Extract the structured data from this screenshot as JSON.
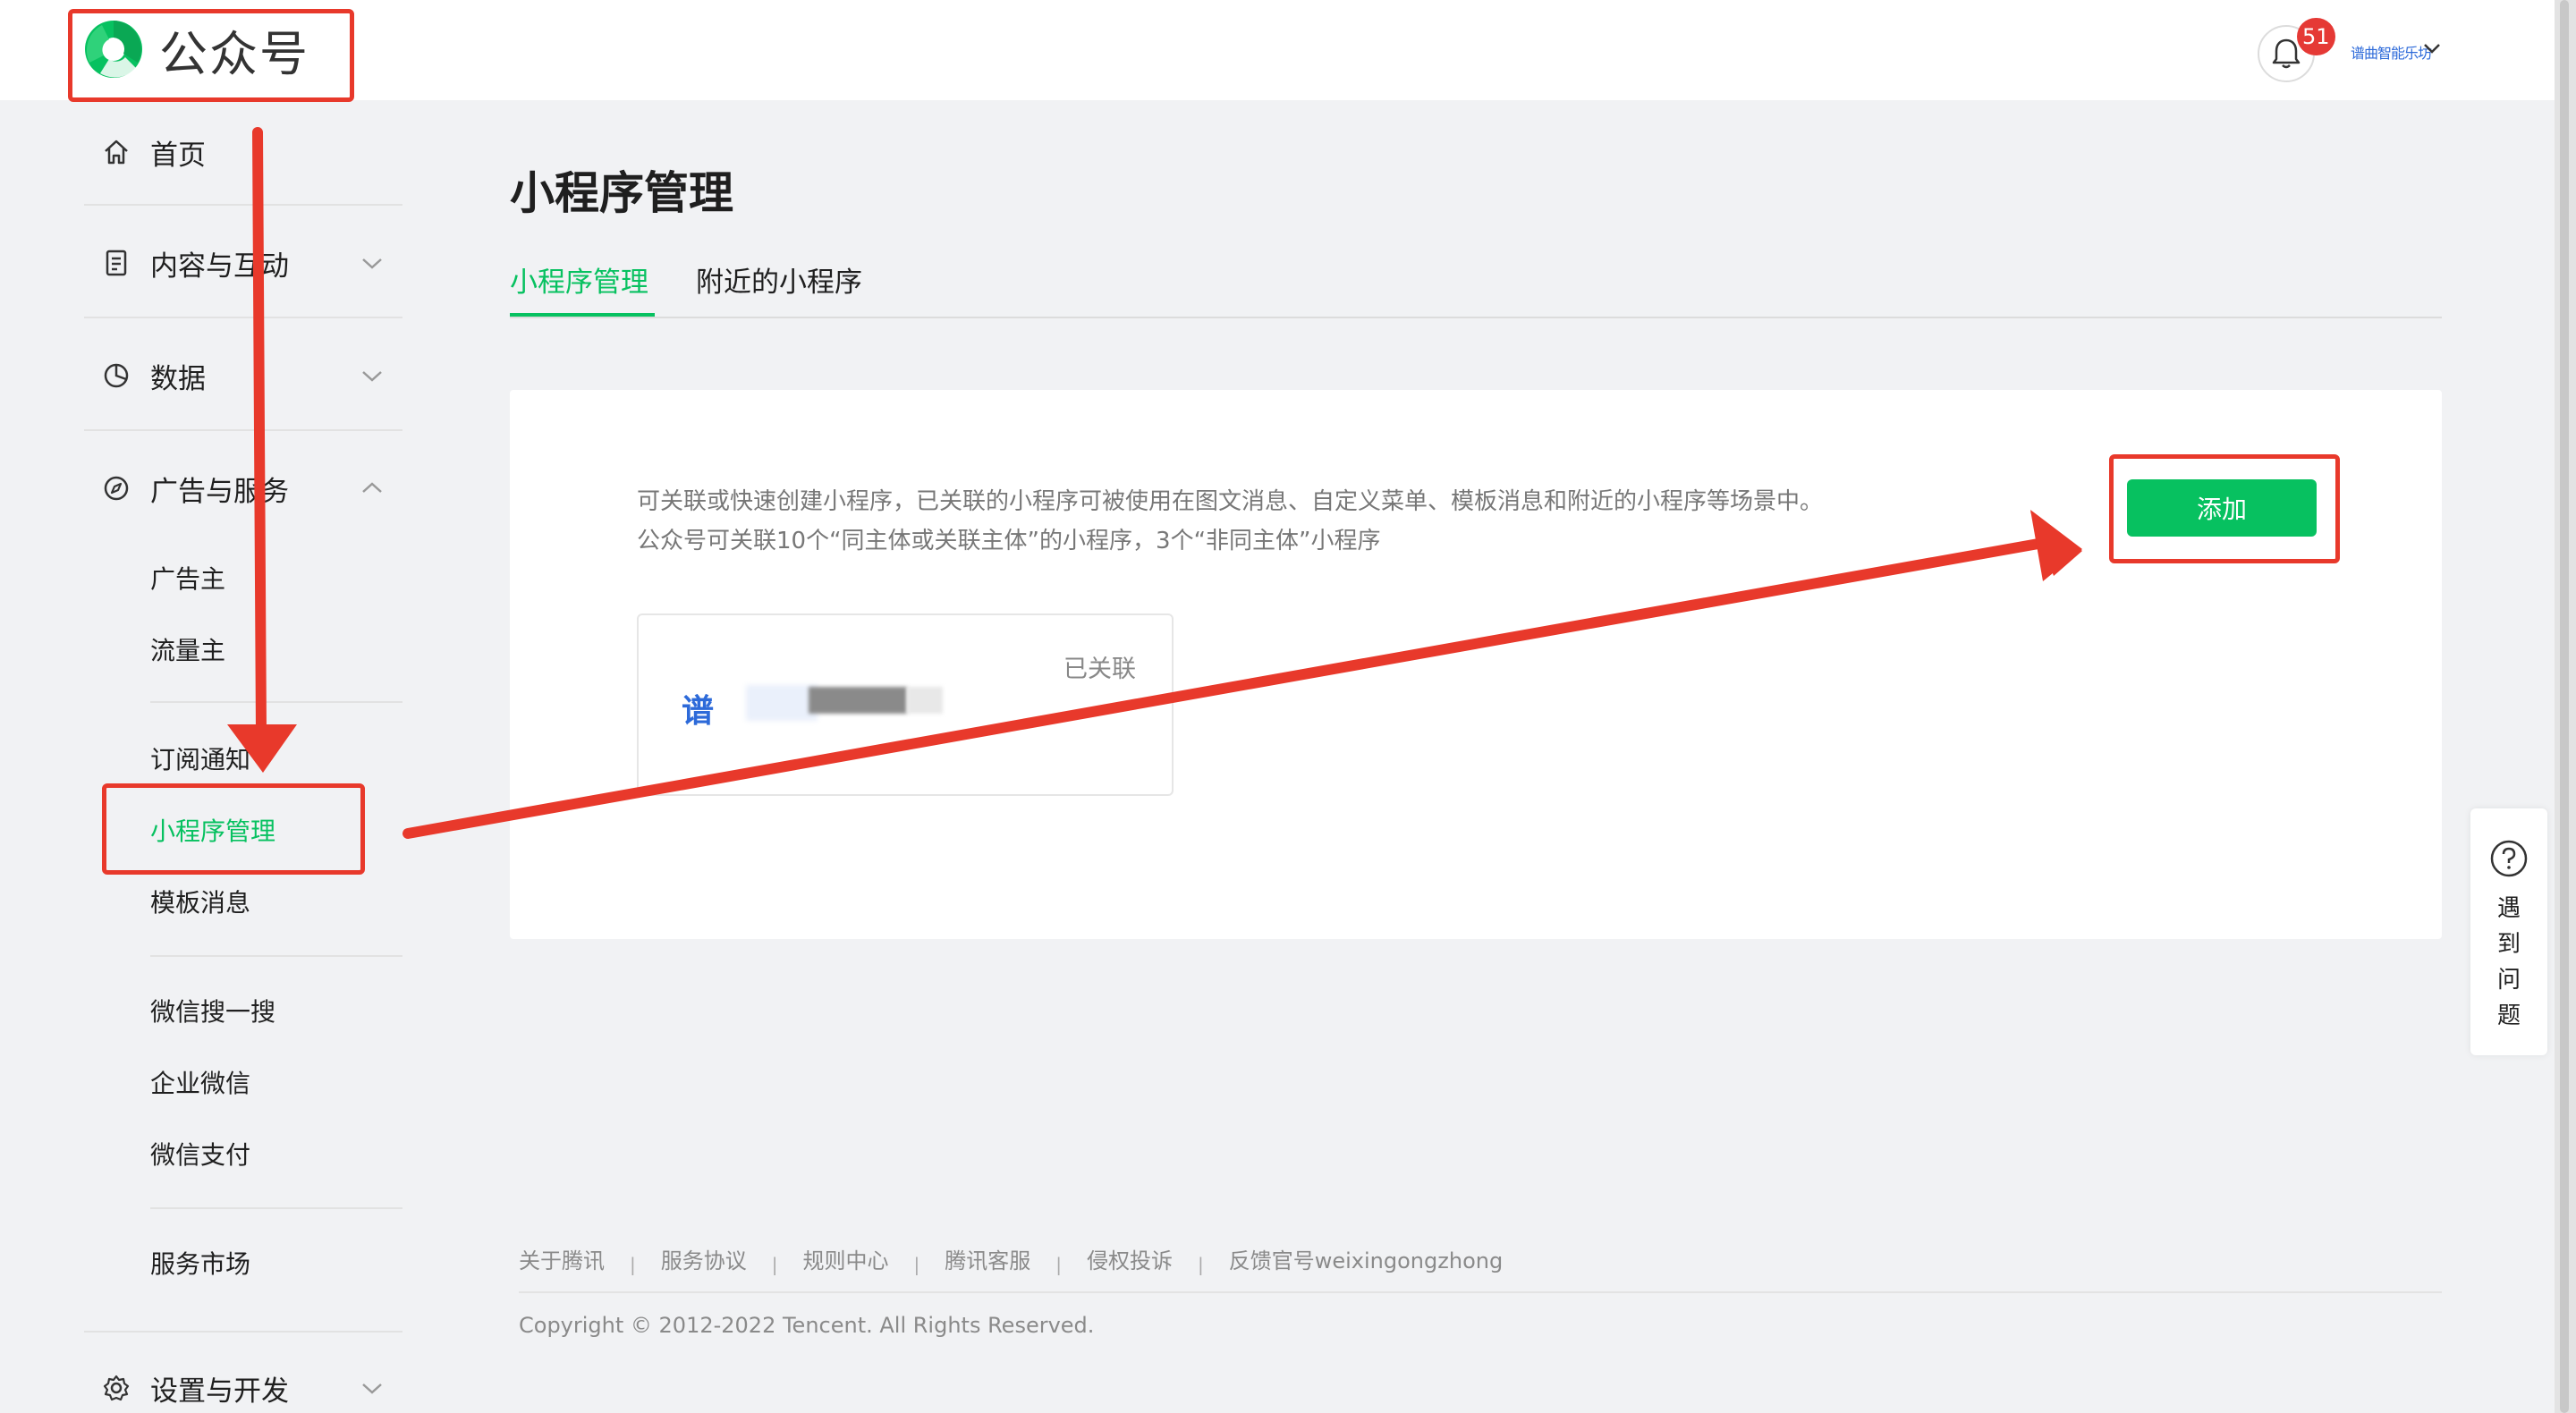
{
  "app": {
    "logo_text": "公众号"
  },
  "header": {
    "notification_count": "51",
    "account_name": "谱曲智能乐坊"
  },
  "sidebar": {
    "home": "首页",
    "content": "内容与互动",
    "data": "数据",
    "ads_services": "广告与服务",
    "sub": {
      "advertiser": "广告主",
      "publisher": "流量主",
      "subscribe_notice": "订阅通知",
      "miniprogram_mgmt": "小程序管理",
      "template_msg": "模板消息",
      "wechat_search": "微信搜一搜",
      "work_wechat": "企业微信",
      "wechat_pay": "微信支付",
      "service_market": "服务市场"
    },
    "settings": "设置与开发"
  },
  "main": {
    "title": "小程序管理",
    "tabs": [
      "小程序管理",
      "附近的小程序"
    ],
    "desc_line1": "可关联或快速创建小程序，已关联的小程序可被使用在图文消息、自定义菜单、模板消息和附近的小程序等场景中。",
    "desc_line2": "公众号可关联10个“同主体或关联主体”的小程序，3个“非同主体”小程序",
    "add_button": "添加",
    "linked_card": {
      "name_prefix": "谱",
      "status": "已关联"
    }
  },
  "footer": {
    "links": [
      "关于腾讯",
      "服务协议",
      "规则中心",
      "腾讯客服",
      "侵权投诉",
      "反馈官号weixingongzhong"
    ],
    "copyright": "Copyright © 2012-2022 Tencent. All Rights Reserved."
  },
  "help_widget": {
    "label": "遇\n到\n问\n题"
  },
  "colors": {
    "brand_green": "#07c160",
    "annotation_red": "#e8392b",
    "badge_red": "#e53935"
  }
}
